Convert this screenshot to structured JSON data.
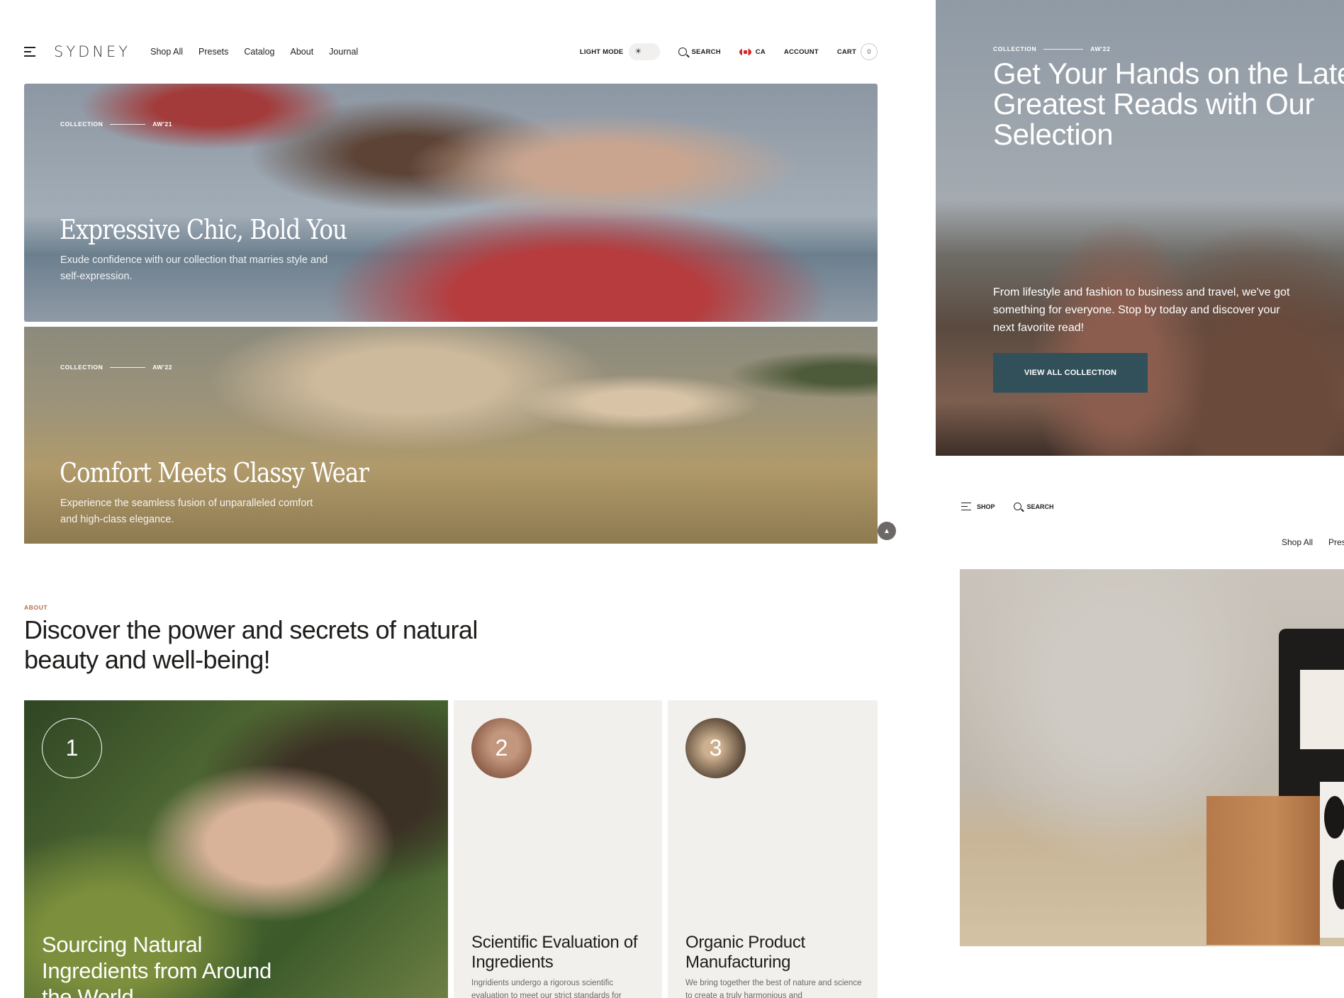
{
  "header": {
    "logo": "SYDNEY",
    "nav": [
      "Shop All",
      "Presets",
      "Catalog",
      "About",
      "Journal"
    ],
    "light_mode_label": "LIGHT MODE",
    "search_label": "SEARCH",
    "country_label": "CA",
    "account_label": "ACCOUNT",
    "cart_label": "CART",
    "cart_count": "0"
  },
  "heroes": [
    {
      "collection_label": "COLLECTION",
      "season": "AW'21",
      "title": "Expressive Chic, Bold You",
      "description": "Exude confidence with our collection that marries style and self-expression."
    },
    {
      "collection_label": "COLLECTION",
      "season": "AW'22",
      "title": "Comfort Meets Classy Wear",
      "description": "Experience the seamless fusion of unparalleled comfort and high-class elegance."
    }
  ],
  "about": {
    "label": "ABOUT",
    "heading": "Discover the power and secrets of natural beauty and well-being!",
    "cards": [
      {
        "number": "1",
        "title": "Sourcing Natural Ingredients from Around the World",
        "text": ""
      },
      {
        "number": "2",
        "title": "Scientific Evaluation of Ingredients",
        "text": "Ingridients undergo a rigorous scientific evaluation to meet our strict standards for"
      },
      {
        "number": "3",
        "title": "Organic Product Manufacturing",
        "text": "We bring together the best of nature and science to create a truly harmonious and"
      }
    ]
  },
  "right_hero": {
    "collection_label": "COLLECTION",
    "season": "AW'22",
    "title": "Get Your Hands on the Latest Greatest Reads with Our Selection",
    "description": "From lifestyle and fashion to business and travel, we've got something for everyone. Stop by today and discover your next favorite read!",
    "button_label": "VIEW ALL COLLECTION",
    "button_color": "#31505a"
  },
  "right_secondary": {
    "shop_label": "SHOP",
    "search_label": "SEARCH",
    "nav": [
      "Shop All",
      "Presets"
    ]
  },
  "colors": {
    "accent_label": "#b06e4b",
    "card_bg": "#f2f0ed"
  },
  "icons": [
    "menu-icon",
    "sun-icon",
    "search-icon",
    "canada-flag-icon",
    "chevron-up-icon"
  ]
}
